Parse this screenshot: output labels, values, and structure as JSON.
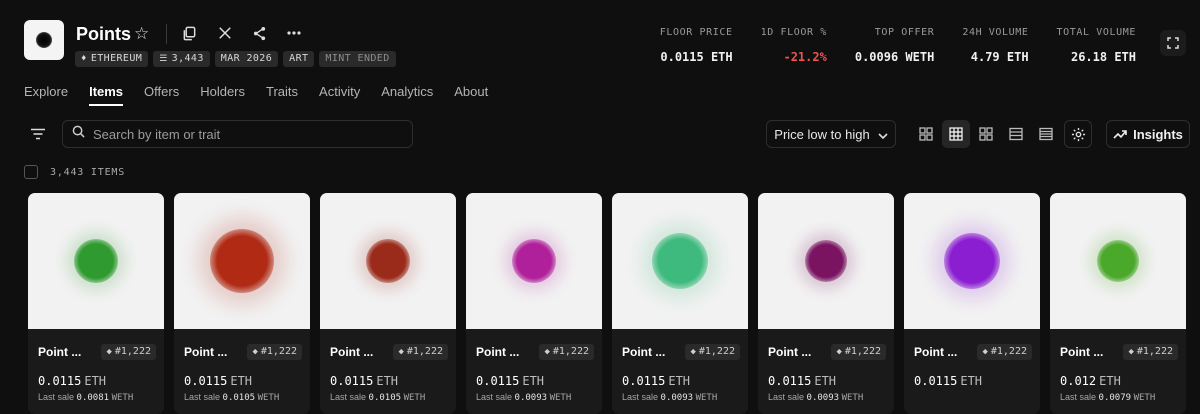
{
  "collection": {
    "title": "Points",
    "tags": [
      {
        "label": "ETHEREUM",
        "icon": "eth-icon"
      },
      {
        "label": "3,443",
        "icon": "stack-icon"
      },
      {
        "label": "MAR 2026",
        "icon": ""
      },
      {
        "label": "ART",
        "icon": ""
      },
      {
        "label": "MINT ENDED",
        "icon": ""
      }
    ]
  },
  "stats": [
    {
      "label": "FLOOR PRICE",
      "value": "0.0115 ETH",
      "negative": false
    },
    {
      "label": "1D FLOOR %",
      "value": "-21.2%",
      "negative": true
    },
    {
      "label": "TOP OFFER",
      "value": "0.0096 WETH",
      "negative": false
    },
    {
      "label": "24H VOLUME",
      "value": "4.79 ETH",
      "negative": false
    },
    {
      "label": "TOTAL VOLUME",
      "value": "26.18 ETH",
      "negative": false
    }
  ],
  "tabs": [
    "Explore",
    "Items",
    "Offers",
    "Holders",
    "Traits",
    "Activity",
    "Analytics",
    "About"
  ],
  "active_tab": "Items",
  "search": {
    "placeholder": "Search by item or trait"
  },
  "sort": {
    "label": "Price low to high"
  },
  "insights_label": "Insights",
  "items_count": "3,443 ITEMS",
  "items": [
    {
      "name": "Point ...",
      "number": "#1,222",
      "price": "0.0115",
      "unit": "ETH",
      "last_label": "Last sale",
      "last_value": "0.0081",
      "last_unit": "WETH",
      "color": "#2f9a2f",
      "size": 44
    },
    {
      "name": "Point ...",
      "number": "#1,222",
      "price": "0.0115",
      "unit": "ETH",
      "last_label": "Last sale",
      "last_value": "0.0105",
      "last_unit": "WETH",
      "color": "#b02a14",
      "size": 64
    },
    {
      "name": "Point ...",
      "number": "#1,222",
      "price": "0.0115",
      "unit": "ETH",
      "last_label": "Last sale",
      "last_value": "0.0105",
      "last_unit": "WETH",
      "color": "#9a2a1a",
      "size": 44
    },
    {
      "name": "Point ...",
      "number": "#1,222",
      "price": "0.0115",
      "unit": "ETH",
      "last_label": "Last sale",
      "last_value": "0.0093",
      "last_unit": "WETH",
      "color": "#b0209a",
      "size": 44
    },
    {
      "name": "Point ...",
      "number": "#1,222",
      "price": "0.0115",
      "unit": "ETH",
      "last_label": "Last sale",
      "last_value": "0.0093",
      "last_unit": "WETH",
      "color": "#3fba7e",
      "size": 56
    },
    {
      "name": "Point ...",
      "number": "#1,222",
      "price": "0.0115",
      "unit": "ETH",
      "last_label": "Last sale",
      "last_value": "0.0093",
      "last_unit": "WETH",
      "color": "#7a1460",
      "size": 42
    },
    {
      "name": "Point ...",
      "number": "#1,222",
      "price": "0.0115",
      "unit": "ETH",
      "last_label": "",
      "last_value": "",
      "last_unit": "",
      "color": "#8a1ed0",
      "size": 56
    },
    {
      "name": "Point ...",
      "number": "#1,222",
      "price": "0.012",
      "unit": "ETH",
      "last_label": "Last sale",
      "last_value": "0.0079",
      "last_unit": "WETH",
      "color": "#4aa82a",
      "size": 42
    }
  ]
}
